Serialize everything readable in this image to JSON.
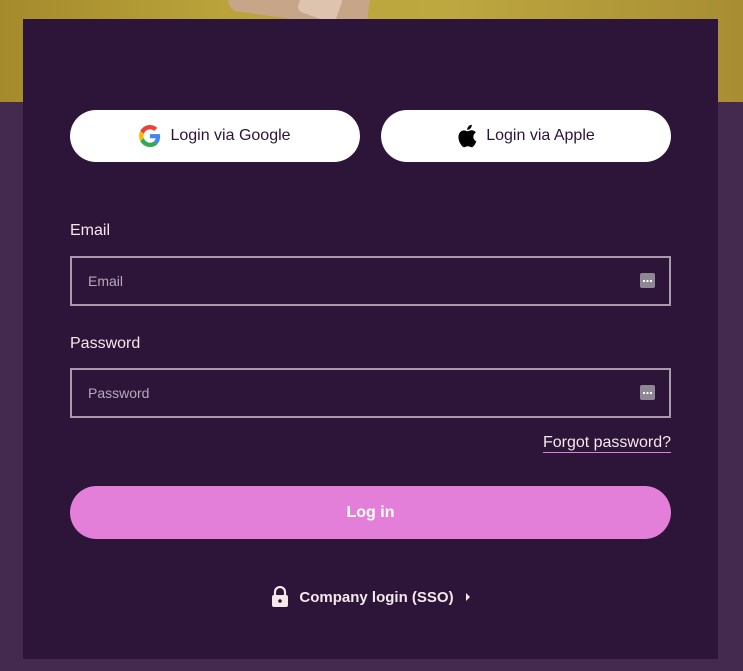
{
  "social": {
    "google_label": "Login via Google",
    "apple_label": "Login via Apple"
  },
  "email": {
    "label": "Email",
    "placeholder": "Email",
    "value": ""
  },
  "password": {
    "label": "Password",
    "placeholder": "Password",
    "value": ""
  },
  "forgot_password": "Forgot password?",
  "login_button": "Log in",
  "company_login": "Company login (SSO)",
  "colors": {
    "card_bg": "#2c1539",
    "page_bg": "#452a4f",
    "accent": "#e47fd9",
    "text": "#f5e7ea"
  },
  "icons": [
    "google-icon",
    "apple-icon",
    "autofill-icon",
    "lock-icon",
    "caret-right-icon"
  ]
}
